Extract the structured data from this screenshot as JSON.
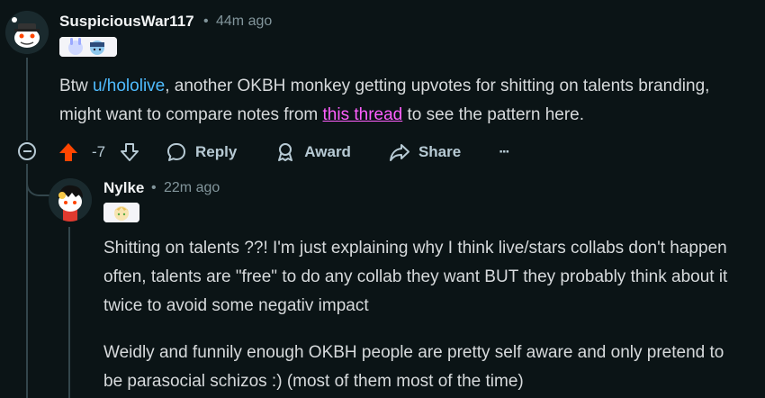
{
  "comment1": {
    "author": "SuspiciousWar117",
    "separator": "•",
    "time": "44m ago",
    "body": {
      "prefix": "Btw ",
      "user_link": "u/hololive",
      "middle": ", another OKBH monkey getting upvotes for shitting on talents branding, might want to compare notes from ",
      "thread_link": "this thread",
      "suffix": " to see the pattern here."
    },
    "actions": {
      "score": "-7",
      "reply": "Reply",
      "award": "Award",
      "share": "Share",
      "more": "···"
    }
  },
  "comment2": {
    "author": "Nylke",
    "separator": "•",
    "time": "22m ago",
    "paragraphs": [
      "Shitting on talents ??! I'm just explaining why I think live/stars collabs don't happen often, talents are \"free\" to do any collab they want BUT they probably think about it twice to avoid some negativ impact",
      "Weidly and funnily enough OKBH people are pretty self aware and only pretend to be parasocial schizos :) (most of them most of the time)"
    ]
  },
  "colors": {
    "background": "#0b1416",
    "upvote_active": "#ff4500",
    "user_link": "#4fbcff",
    "visited_link": "#ff5fff",
    "meta": "#82959b"
  },
  "icons": [
    "snoo-avatar",
    "upvote-icon",
    "downvote-icon",
    "reply-icon",
    "award-icon",
    "share-icon",
    "collapse-icon",
    "overflow-icon"
  ]
}
